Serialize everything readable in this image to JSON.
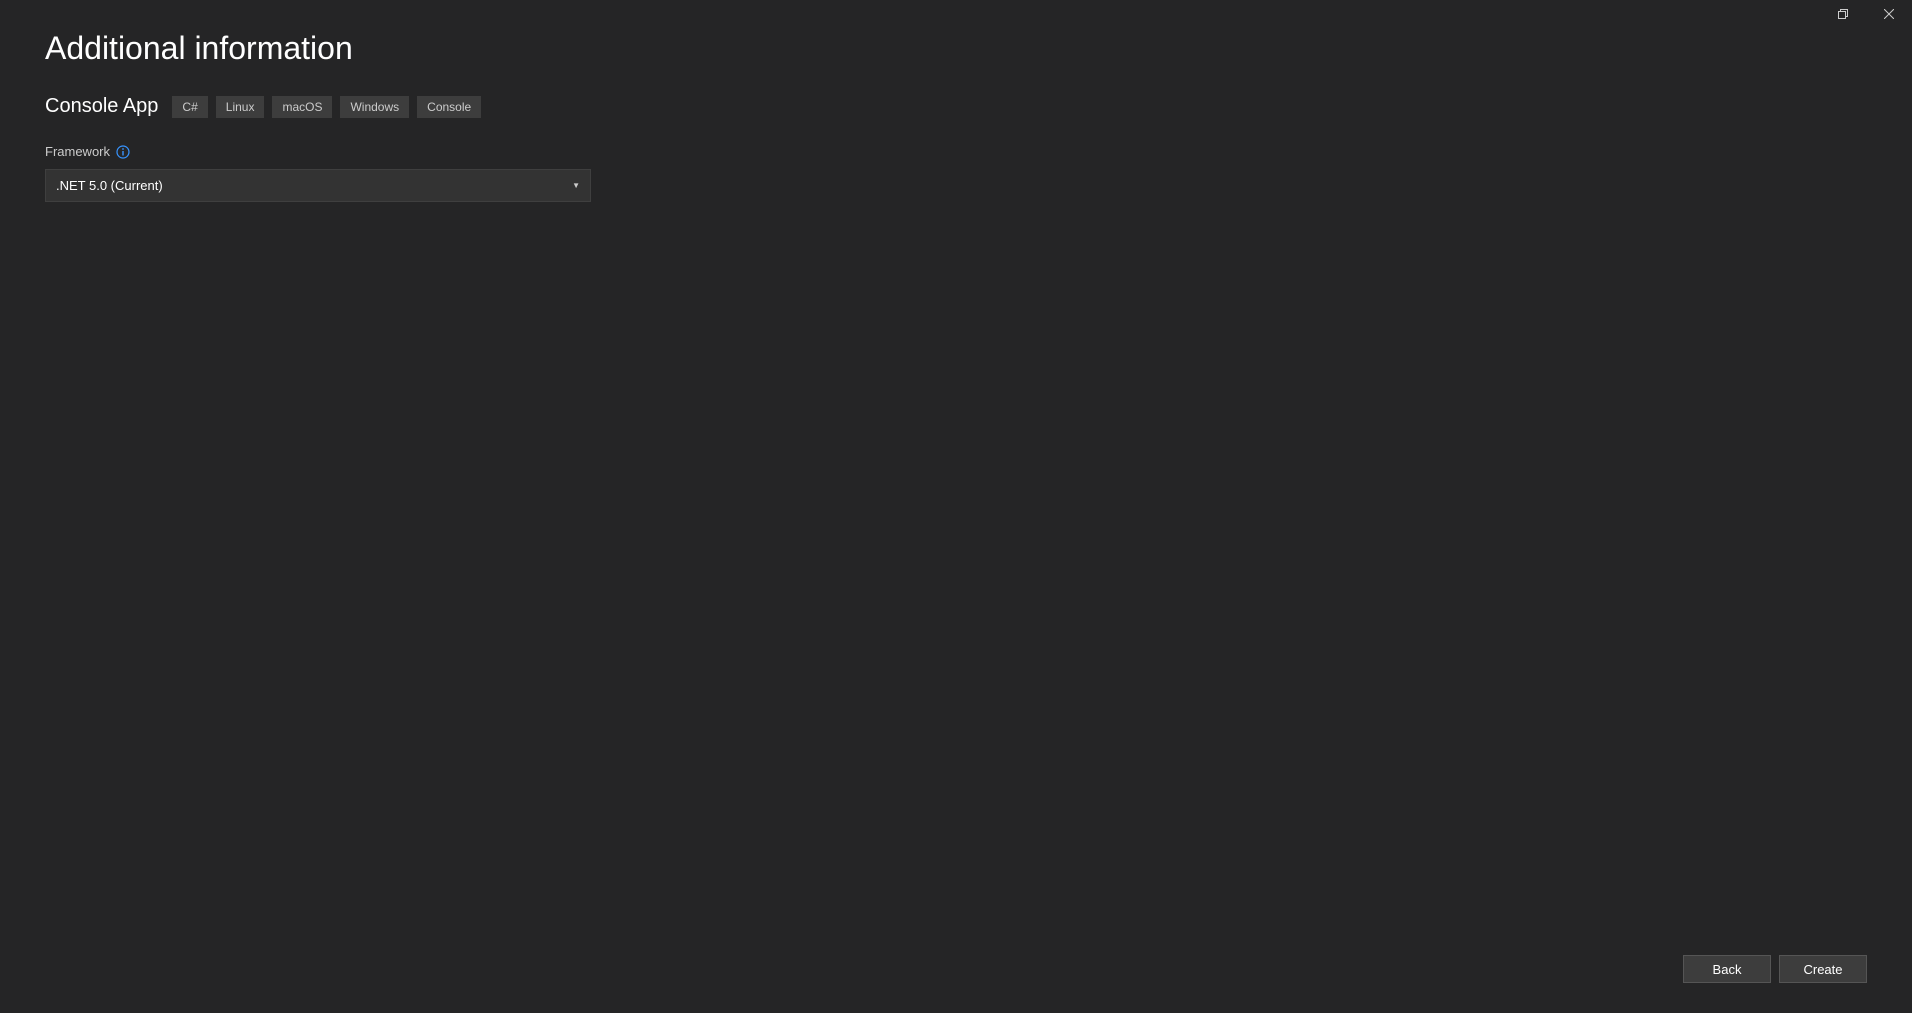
{
  "titlebar": {
    "maximize_icon": "maximize",
    "close_icon": "close"
  },
  "page": {
    "title": "Additional information",
    "subtitle": "Console App",
    "tags": [
      "C#",
      "Linux",
      "macOS",
      "Windows",
      "Console"
    ]
  },
  "form": {
    "framework_label": "Framework",
    "framework_selected": ".NET 5.0 (Current)"
  },
  "footer": {
    "back_label": "Back",
    "create_label": "Create"
  }
}
